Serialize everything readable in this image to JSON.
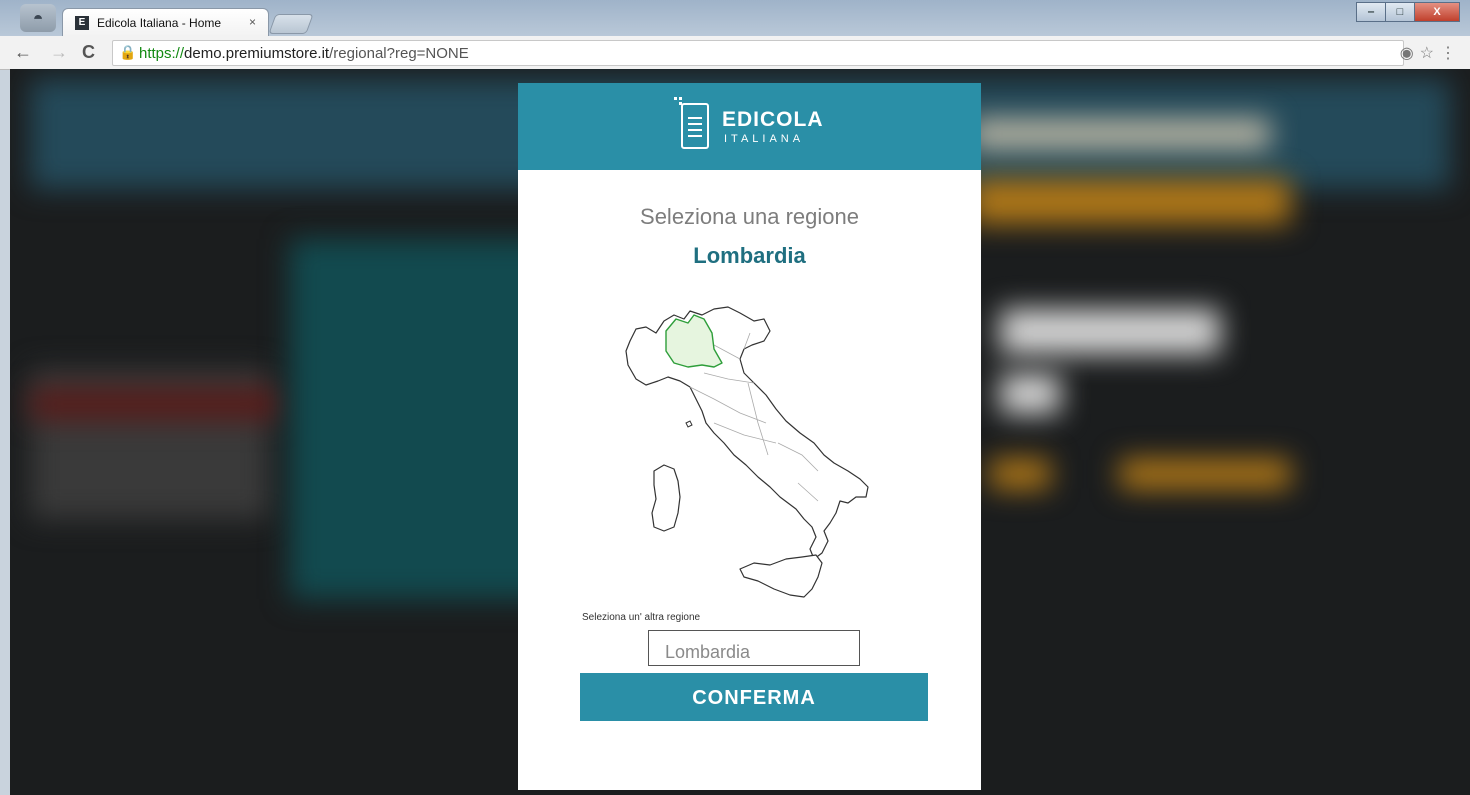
{
  "browser": {
    "tab_title": "Edicola Italiana - Home",
    "tab_close": "×",
    "favicon_letter": "E",
    "url_https": "https://",
    "url_domain": "demo.premiumstore.it",
    "url_path": "/regional?reg=NONE",
    "window_buttons": {
      "minimize": "‒",
      "maximize": "□",
      "close": "X"
    },
    "icons": [
      "incognito-icon",
      "back-icon",
      "forward-icon",
      "reload-icon",
      "lock-icon",
      "location-icon",
      "star-icon",
      "menu-icon"
    ]
  },
  "modal": {
    "logo_line1": "EDICOLA",
    "logo_line2": "ITALIANA",
    "title": "Seleziona una regione",
    "selected_region": "Lombardia",
    "select_label": "Seleziona un' altra regione",
    "select_value": "Lombardia",
    "confirm_label": "CONFERMA",
    "accent_color": "#2a8fa7",
    "region_highlight_color": "#e6f5df"
  }
}
